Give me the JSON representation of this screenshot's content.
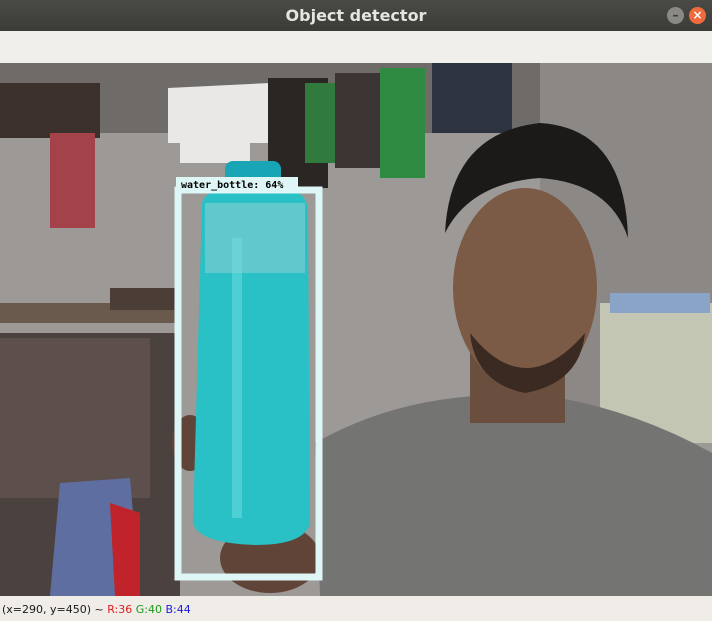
{
  "window": {
    "title": "Object detector",
    "minimize_icon": "minimize-icon",
    "close_icon": "close-icon",
    "minimize_glyph": "–",
    "close_glyph": "×",
    "close_color": "#ef6b3b"
  },
  "detection": {
    "label": "water_bottle: 64%",
    "box_color": "#dff6f6"
  },
  "status": {
    "coords": "(x=290, y=450)",
    "separator": " ~ ",
    "r": "R:36",
    "g": "G:40",
    "b": "B:44"
  }
}
